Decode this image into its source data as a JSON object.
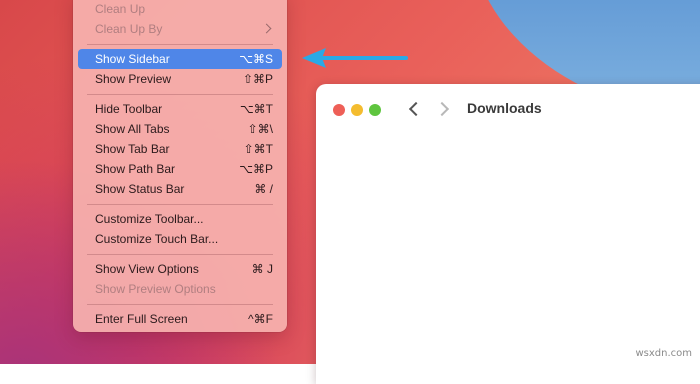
{
  "menu": {
    "items": [
      {
        "label": "Clean Up",
        "shortcut": "",
        "disabled": true
      },
      {
        "label": "Clean Up By",
        "shortcut": "",
        "disabled": true,
        "submenu": true
      },
      {
        "label": "Show Sidebar",
        "shortcut": "⌥⌘S",
        "highlighted": true
      },
      {
        "label": "Show Preview",
        "shortcut": "⇧⌘P"
      },
      {
        "label": "Hide Toolbar",
        "shortcut": "⌥⌘T"
      },
      {
        "label": "Show All Tabs",
        "shortcut": "⇧⌘\\"
      },
      {
        "label": "Show Tab Bar",
        "shortcut": "⇧⌘T"
      },
      {
        "label": "Show Path Bar",
        "shortcut": "⌥⌘P"
      },
      {
        "label": "Show Status Bar",
        "shortcut": "⌘ /"
      },
      {
        "label": "Customize Toolbar...",
        "shortcut": ""
      },
      {
        "label": "Customize Touch Bar...",
        "shortcut": ""
      },
      {
        "label": "Show View Options",
        "shortcut": "⌘ J"
      },
      {
        "label": "Show Preview Options",
        "shortcut": "",
        "disabled": true
      },
      {
        "label": "Enter Full Screen",
        "shortcut": "^⌘F"
      }
    ]
  },
  "window": {
    "title": "Downloads"
  },
  "watermark": "wsxdn.com",
  "colors": {
    "highlight": "#4f86e8",
    "arrow": "#2aa9e6",
    "close": "#ee5f57",
    "minimize": "#f4bc2f",
    "zoom": "#5fc53f"
  }
}
